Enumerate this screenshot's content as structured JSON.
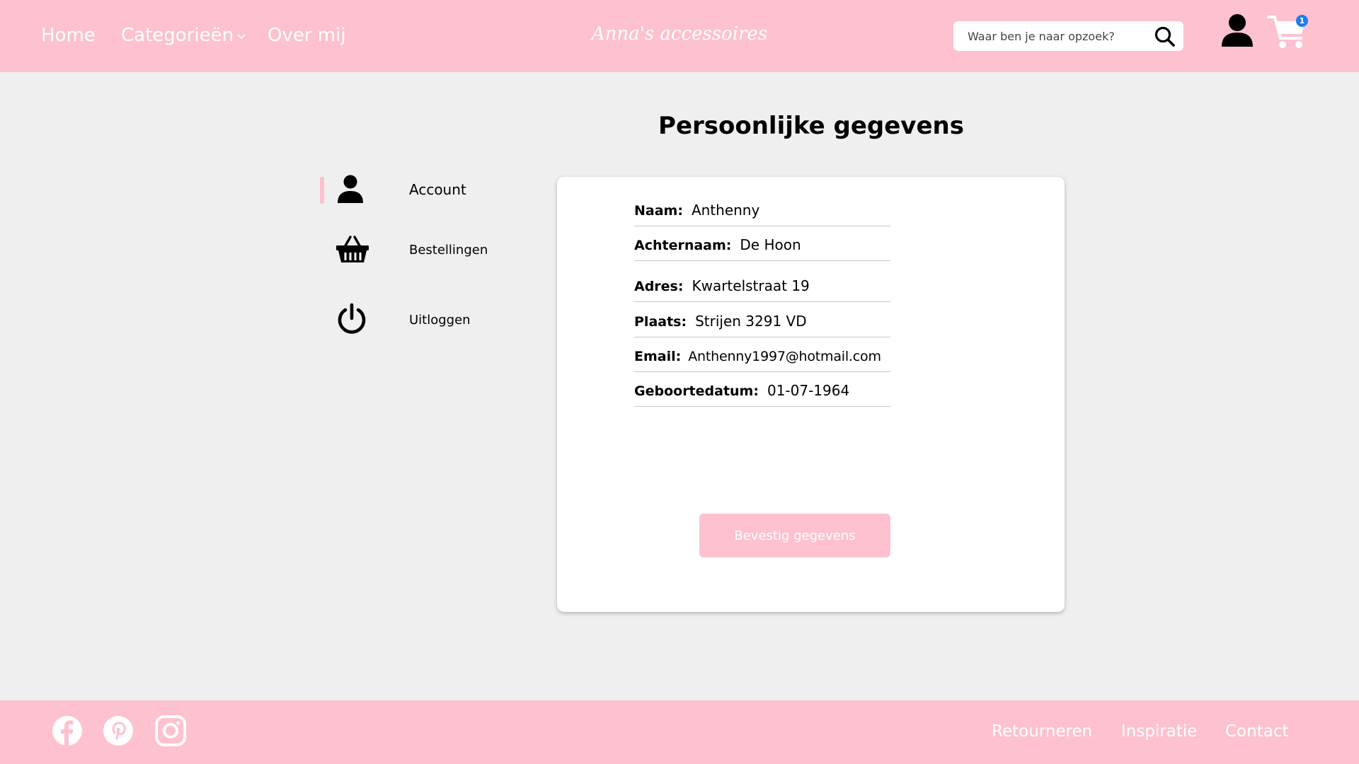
{
  "header": {
    "nav": {
      "home": "Home",
      "categories": "Categorieën",
      "about": "Over mij"
    },
    "brand": "Anna's accessoires",
    "search": {
      "placeholder": "Waar ben je naar opzoek?",
      "value": ""
    },
    "cart_count": "1"
  },
  "main": {
    "title": "Persoonlijke gegevens",
    "sidebar": {
      "items": [
        {
          "label": "Account",
          "icon": "user-icon",
          "active": true
        },
        {
          "label": "Bestellingen",
          "icon": "basket-icon",
          "active": false
        },
        {
          "label": "Uitloggen",
          "icon": "power-icon",
          "active": false
        }
      ]
    },
    "fields": [
      {
        "label": "Naam:",
        "value": "Anthenny"
      },
      {
        "label": "Achternaam:",
        "value": "De Hoon"
      },
      {
        "label": "Adres:",
        "value": "Kwartelstraat 19"
      },
      {
        "label": "Plaats:",
        "value": "Strijen 3291 VD"
      },
      {
        "label": "Email:",
        "value": "Anthenny1997@hotmail.com"
      },
      {
        "label": "Geboortedatum:",
        "value": "01-07-1964"
      }
    ],
    "confirm_label": "Bevestig gegevens"
  },
  "footer": {
    "social": [
      "facebook-icon",
      "pinterest-icon",
      "instagram-icon"
    ],
    "links": {
      "returns": "Retourneren",
      "inspiration": "Inspiratie",
      "contact": "Contact"
    }
  },
  "colors": {
    "pink": "#fec1cf",
    "background": "#efefef",
    "badge": "#1a7df0"
  }
}
